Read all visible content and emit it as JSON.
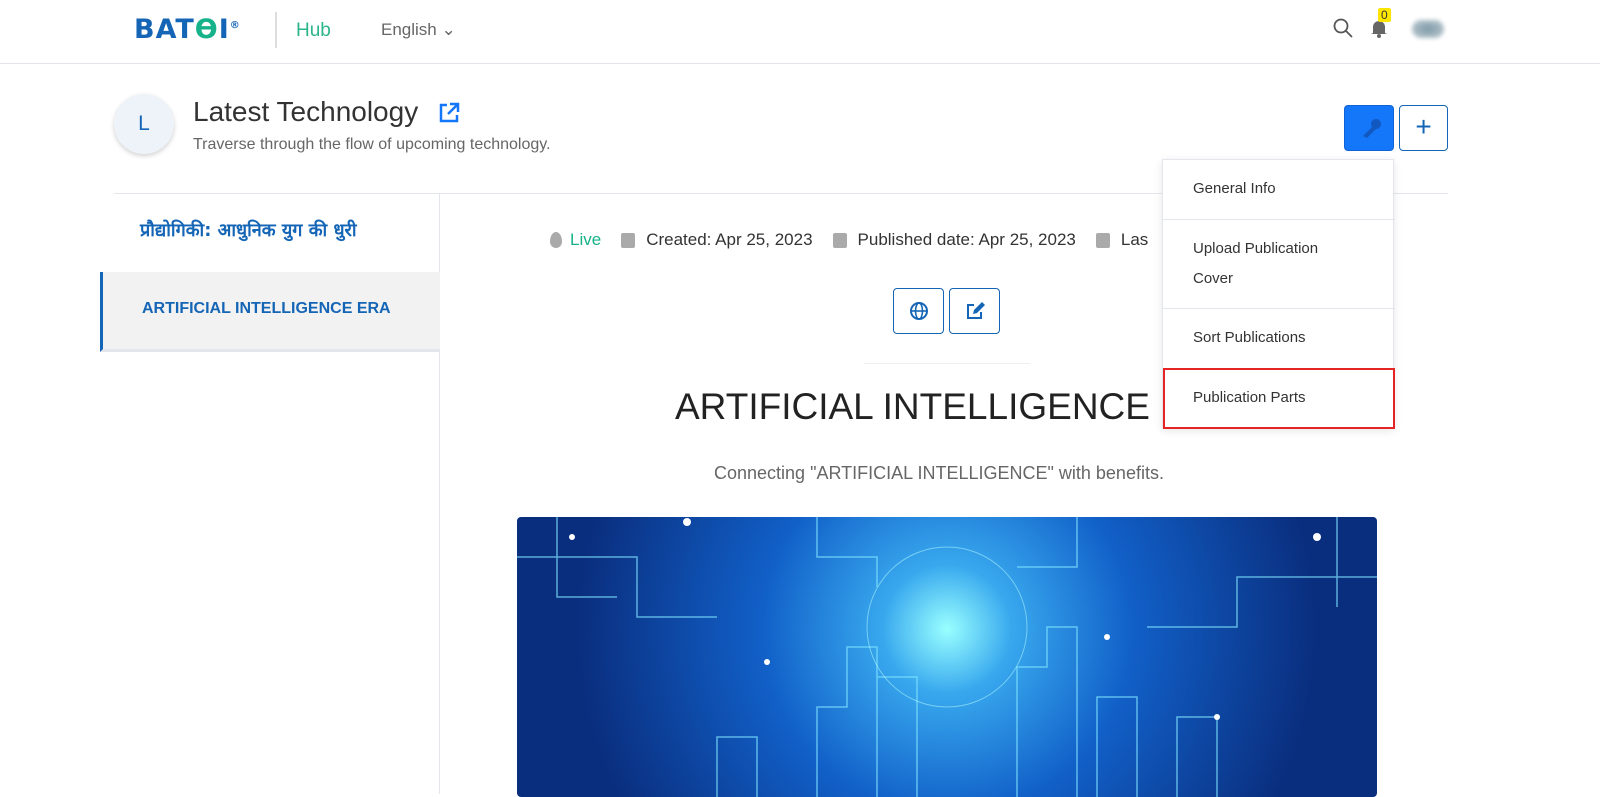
{
  "header": {
    "logo": "BATOI",
    "hub": "Hub",
    "language": "English",
    "notification_count": "0"
  },
  "publication": {
    "initial": "L",
    "title": "Latest Technology",
    "subtitle": "Traverse through the flow of upcoming technology."
  },
  "sidebar": {
    "heading": "प्रौद्योगिकी: आधुनिक युग की धुरी",
    "items": [
      {
        "label": "ARTIFICIAL INTELLIGENCE ERA",
        "active": true
      }
    ]
  },
  "meta": {
    "status": "Live",
    "created": "Created: Apr 25, 2023",
    "published": "Published date: Apr 25, 2023",
    "last": "Las"
  },
  "article": {
    "title": "ARTIFICIAL INTELLIGENCE ERA",
    "description": "Connecting \"ARTIFICIAL INTELLIGENCE\" with benefits."
  },
  "menu": {
    "items": [
      "General Info",
      "Upload Publication Cover",
      "Sort Publications",
      "Publication Parts"
    ],
    "highlighted": "Publication Parts"
  },
  "colors": {
    "accent": "#1565b6",
    "live": "#16b38a",
    "primary_button": "#1476f8",
    "highlight": "#e52525"
  }
}
